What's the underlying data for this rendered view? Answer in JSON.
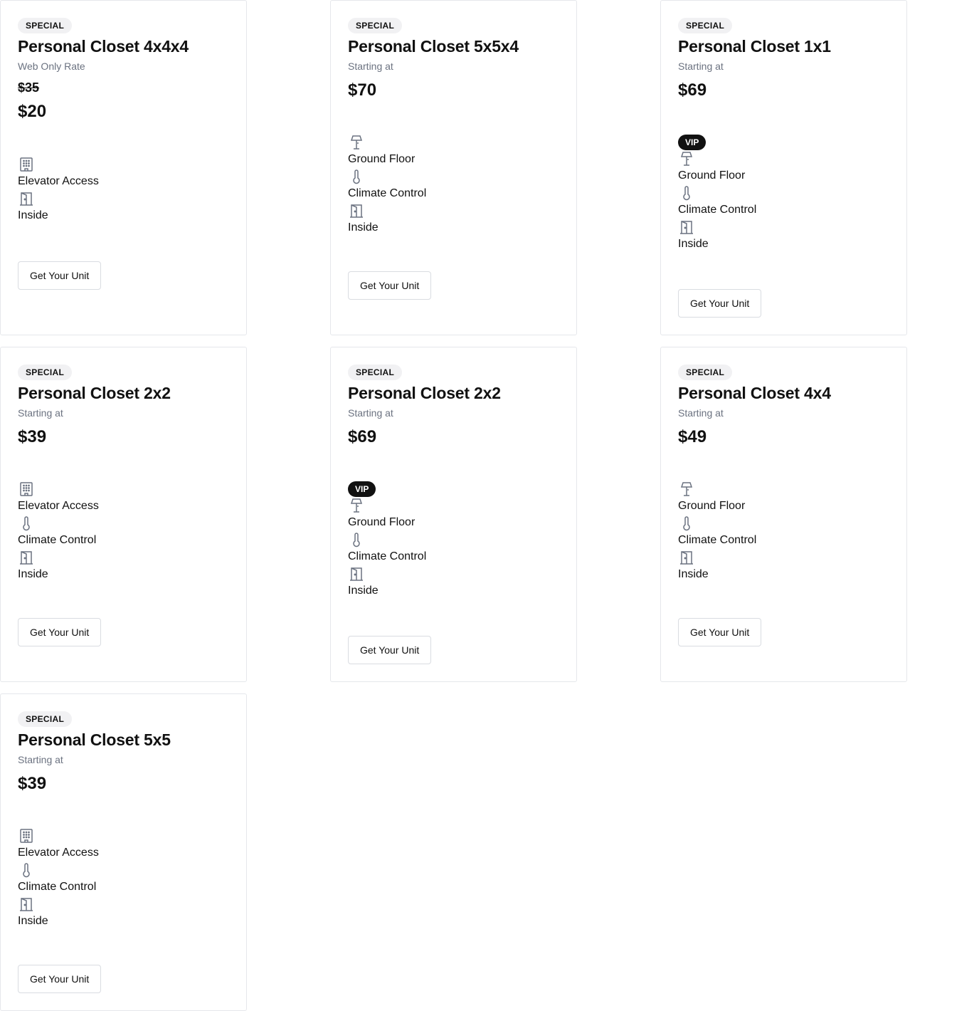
{
  "cards": [
    {
      "badge": "SPECIAL",
      "title": "Personal Closet 4x4x4",
      "rate_label": "Web Only Rate",
      "old_price": "$35",
      "price": "$20",
      "features": [
        "Elevator Access",
        "Inside"
      ],
      "cta": "Get Your Unit"
    },
    {
      "badge": "SPECIAL",
      "title": "Personal Closet 5x5x4",
      "rate_label": "Starting at",
      "price": "$70",
      "features": [
        "Ground Floor",
        "Climate Control",
        "Inside"
      ],
      "cta": "Get Your Unit"
    },
    {
      "badge": "SPECIAL",
      "title": "Personal Closet 1x1",
      "rate_label": "Starting at",
      "price": "$69",
      "vip": "VIP",
      "features": [
        "Ground Floor",
        "Climate Control",
        "Inside"
      ],
      "cta": "Get Your Unit"
    },
    {
      "badge": "SPECIAL",
      "title": "Personal Closet 2x2",
      "rate_label": "Starting at",
      "price": "$39",
      "features": [
        "Elevator Access",
        "Climate Control",
        "Inside"
      ],
      "cta": "Get Your Unit"
    },
    {
      "badge": "SPECIAL",
      "title": "Personal Closet 2x2",
      "rate_label": "Starting at",
      "price": "$69",
      "vip": "VIP",
      "features": [
        "Ground Floor",
        "Climate Control",
        "Inside"
      ],
      "cta": "Get Your Unit"
    },
    {
      "badge": "SPECIAL",
      "title": "Personal Closet 4x4",
      "rate_label": "Starting at",
      "price": "$49",
      "features": [
        "Ground Floor",
        "Climate Control",
        "Inside"
      ],
      "cta": "Get Your Unit"
    },
    {
      "badge": "SPECIAL",
      "title": "Personal Closet 5x5",
      "rate_label": "Starting at",
      "price": "$39",
      "features": [
        "Elevator Access",
        "Climate Control",
        "Inside"
      ],
      "cta": "Get Your Unit"
    }
  ]
}
